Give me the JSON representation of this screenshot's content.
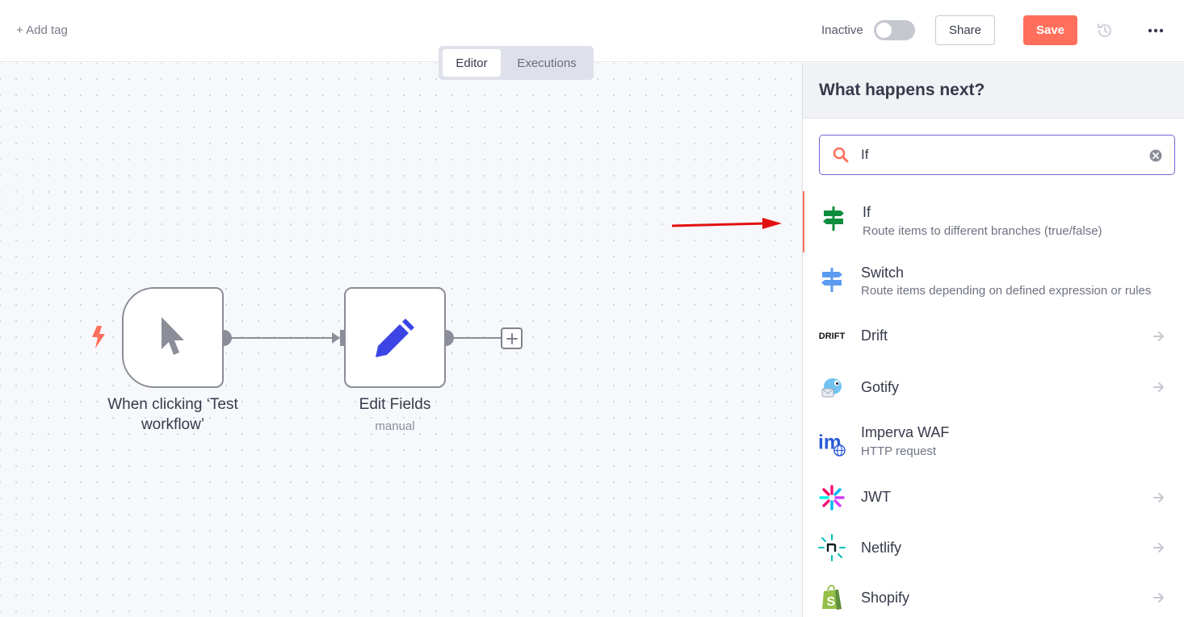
{
  "header": {
    "add_tag": "+ Add tag",
    "active_label": "Inactive",
    "active_state": false,
    "share_label": "Share",
    "save_label": "Save"
  },
  "tabs": [
    {
      "label": "Editor",
      "active": true
    },
    {
      "label": "Executions",
      "active": false
    }
  ],
  "workflow": {
    "nodes": [
      {
        "title": "When clicking ‘Test workflow’",
        "subtitle": ""
      },
      {
        "title": "Edit Fields",
        "subtitle": "manual"
      }
    ]
  },
  "panel": {
    "title": "What happens next?",
    "search_value": "If",
    "items": [
      {
        "name": "If",
        "description": "Route items to different branches (true/false)",
        "icon": "signpost-icon",
        "selected": true
      },
      {
        "name": "Switch",
        "description": "Route items depending on defined expression or rules",
        "icon": "signpost-icon",
        "selected": false
      },
      {
        "name": "Drift",
        "description": "",
        "icon": "drift-logo-icon",
        "selected": false
      },
      {
        "name": "Gotify",
        "description": "",
        "icon": "gotify-logo-icon",
        "selected": false
      },
      {
        "name": "Imperva WAF",
        "description": "HTTP request",
        "icon": "imperva-logo-icon",
        "selected": false
      },
      {
        "name": "JWT",
        "description": "",
        "icon": "jwt-logo-icon",
        "selected": false
      },
      {
        "name": "Netlify",
        "description": "",
        "icon": "netlify-logo-icon",
        "selected": false
      },
      {
        "name": "Shopify",
        "description": "",
        "icon": "shopify-logo-icon",
        "selected": false
      }
    ],
    "drift_logo_text": "DRIFT"
  },
  "colors": {
    "accent": "#ff6f5c",
    "search_border": "#7b61d6",
    "edit_icon": "#3b45e6",
    "if_icon": "#0f8d3e",
    "switch_icon": "#5b9bf0",
    "annotation_arrow": "#e31010"
  }
}
